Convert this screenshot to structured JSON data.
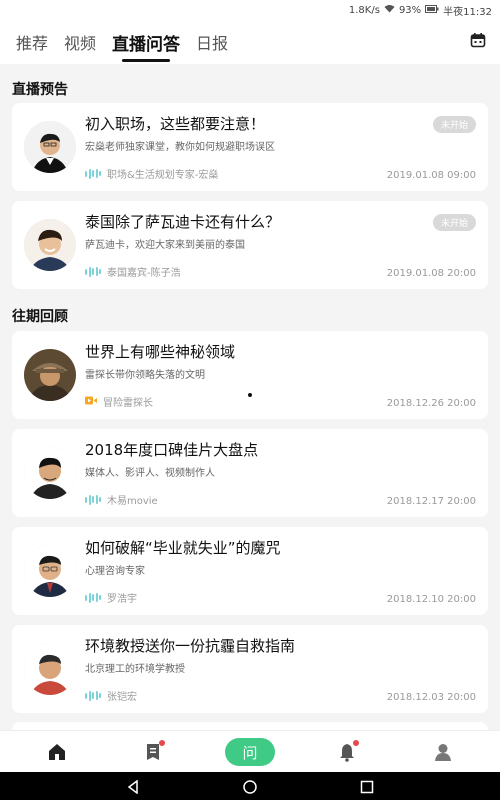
{
  "status_bar": {
    "net_speed": "1.8K/s",
    "battery": "93%",
    "time": "半夜11:32"
  },
  "tabs": [
    {
      "label": "推荐"
    },
    {
      "label": "视频"
    },
    {
      "label": "直播问答"
    },
    {
      "label": "日报"
    }
  ],
  "active_tab": "直播问答",
  "upcoming": {
    "title": "直播预告",
    "items": [
      {
        "title": "初入职场，这些都要注意！",
        "desc": "宏燊老师独家课堂，教你如何规避职场误区",
        "host": "职场&生活规划专家-宏燊",
        "time": "2019.01.08 09:00",
        "badge": "未开始",
        "host_icon": "audio-wave-icon"
      },
      {
        "title": "泰国除了萨瓦迪卡还有什么？",
        "desc": "萨瓦迪卡，欢迎大家来到美丽的泰国",
        "host": "泰国嘉宾-陈子浩",
        "time": "2019.01.08 20:00",
        "badge": "未开始",
        "host_icon": "audio-wave-icon"
      }
    ]
  },
  "past": {
    "title": "往期回顾",
    "items": [
      {
        "title": "世界上有哪些神秘领域",
        "desc": "雷探长带你领略失落的文明",
        "host": "冒险雷探长",
        "time": "2018.12.26 20:00",
        "host_icon": "video-icon"
      },
      {
        "title": "2018年度口碑佳片大盘点",
        "desc": "媒体人、影评人、视频制作人",
        "host": "木易movie",
        "time": "2018.12.17 20:00",
        "host_icon": "audio-wave-icon"
      },
      {
        "title": "如何破解“毕业就失业”的魔咒",
        "desc": "心理咨询专家",
        "host": "罗浩宇",
        "time": "2018.12.10 20:00",
        "host_icon": "audio-wave-icon"
      },
      {
        "title": "环境教授送你一份抗霾自救指南",
        "desc": "北京理工的环境学教授",
        "host": "张铠宏",
        "time": "2018.12.03 20:00",
        "host_icon": "audio-wave-icon"
      }
    ]
  },
  "bottom_nav": {
    "ask_label": "问",
    "icons": [
      "home-icon",
      "news-icon",
      "ask-icon",
      "bell-icon",
      "profile-icon"
    ]
  },
  "colors": {
    "accent_green": "#3fca86",
    "wave_teal": "#7dd3d8",
    "video_orange": "#f5a623",
    "notification_red": "#e5484d"
  }
}
